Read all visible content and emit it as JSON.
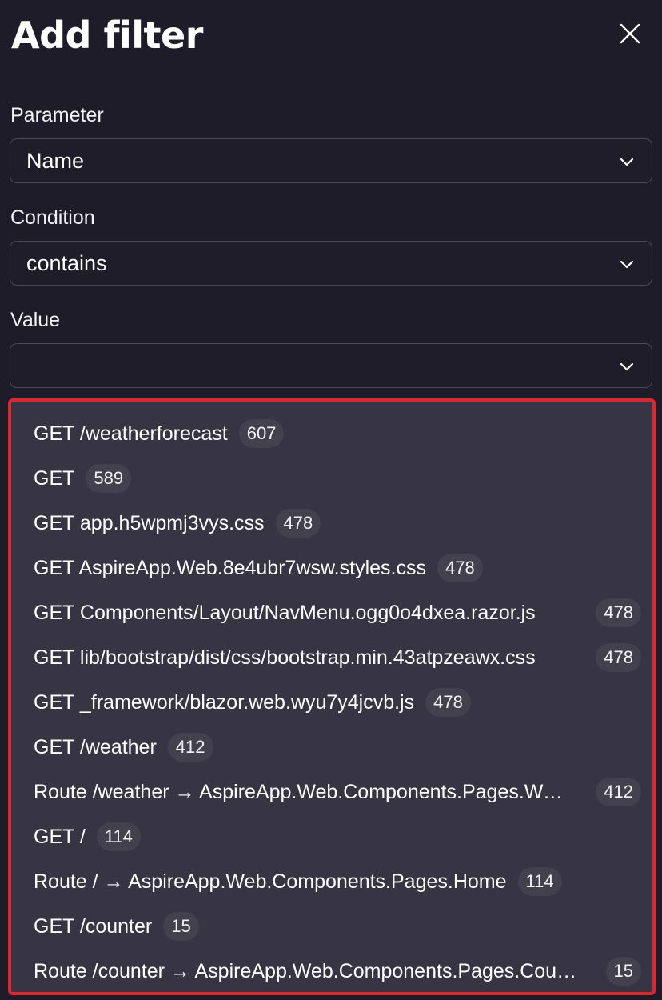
{
  "dialog": {
    "title": "Add filter",
    "close_icon": "close-icon"
  },
  "parameter": {
    "label": "Parameter",
    "value": "Name",
    "icon": "chevron-down-icon"
  },
  "condition": {
    "label": "Condition",
    "value": "contains",
    "icon": "chevron-down-icon"
  },
  "value_field": {
    "label": "Value",
    "value": "",
    "icon": "chevron-down-icon"
  },
  "options": [
    {
      "text": "GET /weatherforecast",
      "count": "607"
    },
    {
      "text": "GET",
      "count": "589"
    },
    {
      "text": "GET app.h5wpmj3vys.css",
      "count": "478"
    },
    {
      "text": "GET AspireApp.Web.8e4ubr7wsw.styles.css",
      "count": "478"
    },
    {
      "text": "GET Components/Layout/NavMenu.ogg0o4dxea.razor.js",
      "count": "478"
    },
    {
      "text": "GET lib/bootstrap/dist/css/bootstrap.min.43atpzeawx.css",
      "count": "478"
    },
    {
      "text": "GET _framework/blazor.web.wyu7y4jcvb.js",
      "count": "478"
    },
    {
      "text": "GET /weather",
      "count": "412"
    },
    {
      "text": "Route /weather → AspireApp.Web.Components.Pages.Weather",
      "count": "412"
    },
    {
      "text": "GET /",
      "count": "114"
    },
    {
      "text": "Route / → AspireApp.Web.Components.Pages.Home",
      "count": "114"
    },
    {
      "text": "GET /counter",
      "count": "15"
    },
    {
      "text": "Route /counter → AspireApp.Web.Components.Pages.Counter",
      "count": "15"
    }
  ],
  "colors": {
    "background": "#1e1c28",
    "dropdown_background": "#373444",
    "highlight_border": "#e1252b",
    "badge_background": "#44414f"
  }
}
